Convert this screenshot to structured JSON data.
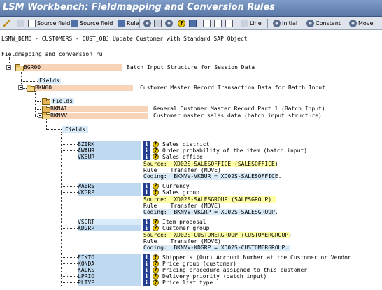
{
  "window": {
    "title": "LSM Workbench: Fieldmapping and Conversion Rules"
  },
  "toolbar": {
    "source_field_1": "Source field",
    "source_field_2": "Source field",
    "rule": "Rule",
    "line": "Line",
    "initial": "Initial",
    "constant": "Constant",
    "move": "Move"
  },
  "header": {
    "path": "LSMW_DEMO - CUSTOMERS - CUST_OBJ Update Customer with Standard SAP Object",
    "tree_title": "Fieldmapping and conversion ru"
  },
  "structures": {
    "bgr00": {
      "name": "BGR00",
      "desc": "Batch Input Structure for Session Data"
    },
    "fields_label": "Fields",
    "bkn00": {
      "name": "BKN00",
      "desc": "Customer Master Record Transaction Data for Batch Input"
    },
    "bkna1": {
      "name": "BKNA1",
      "desc": "General Customer Master Record Part 1 (Batch Input)"
    },
    "bknvv": {
      "name": "BKNVV",
      "desc": "Customer master sales data (batch input structure)"
    }
  },
  "fields": [
    {
      "name": "BZIRK",
      "desc": "Sales district"
    },
    {
      "name": "AWAHR",
      "desc": "Order probability of the item (batch input)"
    },
    {
      "name": "VKBUR",
      "desc": "Sales office"
    },
    {
      "name": "WAERS",
      "desc": "Currency"
    },
    {
      "name": "VKGRP",
      "desc": "Sales group"
    },
    {
      "name": "VSORT",
      "desc": "Item proposal"
    },
    {
      "name": "KDGRP",
      "desc": "Customer group"
    },
    {
      "name": "EIKTO",
      "desc": "Shipper's (Our) Account Number at the Customer or Vendor"
    },
    {
      "name": "KONDA",
      "desc": "Price group (customer)"
    },
    {
      "name": "KALKS",
      "desc": "Pricing procedure assigned to this customer"
    },
    {
      "name": "LPRIO",
      "desc": "Delivery priority (batch input)"
    },
    {
      "name": "PLTYP",
      "desc": "Price list type"
    }
  ],
  "rules": {
    "vkbur": {
      "source": "Source:  XD02S-SALESOFFICE (SALESOFFICE)",
      "rule": "Rule :  Transfer (MOVE)",
      "coding": "Coding:  BKNVV-VKBUR = XD02S-SALESOFFICE."
    },
    "vkgrp": {
      "source": "Source:  XD02S-SALESGROUP (SALESGROUP)",
      "rule": "Rule :  Transfer (MOVE)",
      "coding": "Coding:  BKNVV-VKGRP = XD02S-SALESGROUP."
    },
    "kdgrp": {
      "source": "Source:  XD02S-CUSTOMERGROUP (CUSTOMERGROUP)",
      "rule": "Rule :  Transfer (MOVE)",
      "coding": "Coding:  BKNVV-KDGRP = XD02S-CUSTOMERGROUP."
    }
  },
  "icons": {
    "info": "i",
    "help": "?"
  },
  "colors": {
    "peach": "#f7d3b8",
    "blue": "#bfdaf0",
    "yellow": "#ffffa8",
    "title": "#5a77a6"
  }
}
